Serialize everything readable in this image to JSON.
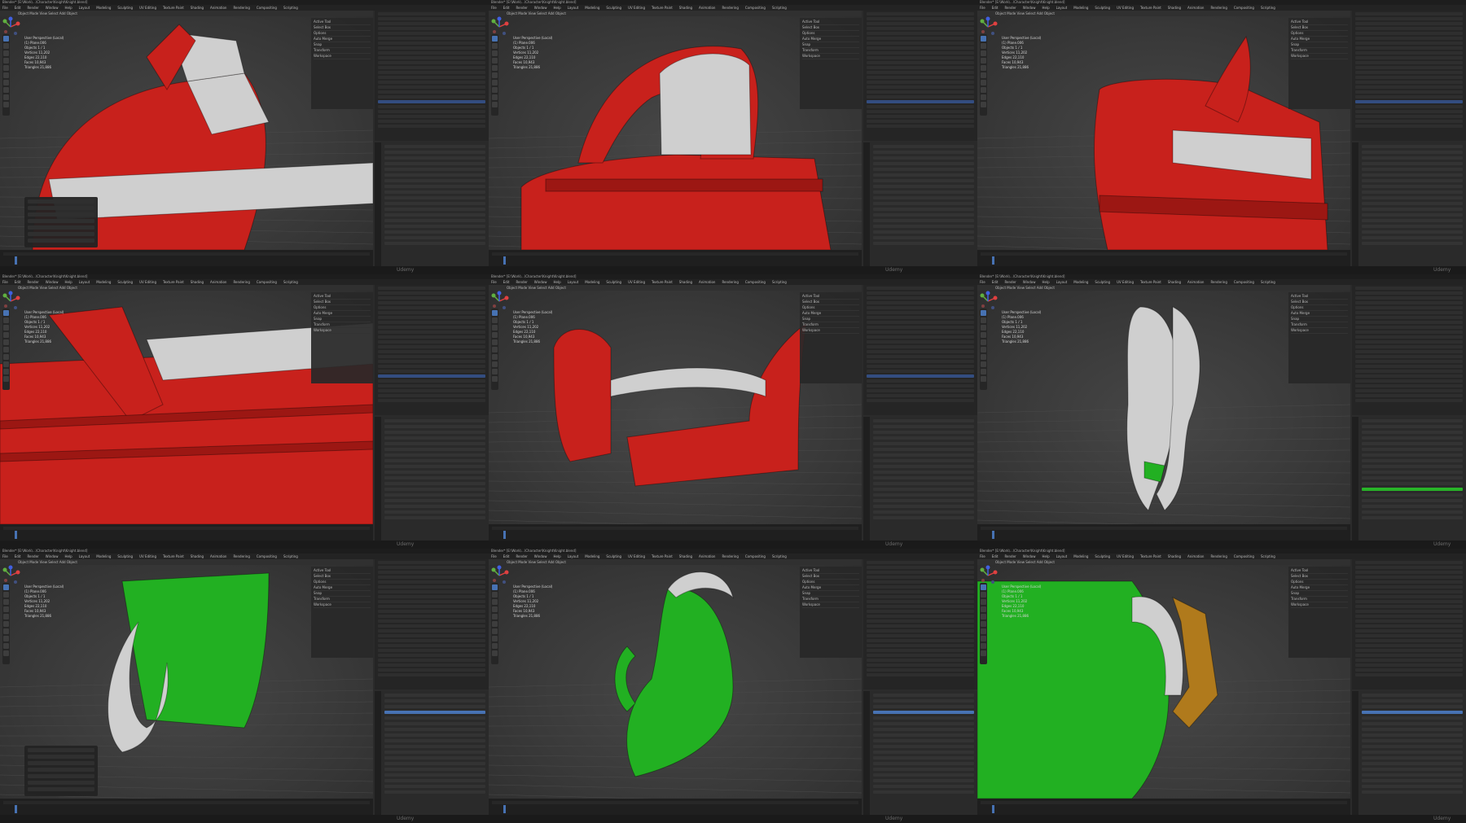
{
  "app": {
    "window_title": "Blender* [E:\\Work\\...\\Character\\Knight\\Knight.blend]",
    "menus": [
      "File",
      "Edit",
      "Render",
      "Window",
      "Help",
      "Layout",
      "Modeling",
      "Sculpting",
      "UV Editing",
      "Texture Paint",
      "Shading",
      "Animation",
      "Rendering",
      "Compositing",
      "Scripting"
    ],
    "view_header": [
      "Object Mode",
      "View",
      "Select",
      "Add",
      "Object"
    ],
    "viewport_info": [
      "User Perspective (Local)",
      "(1) Plane.006",
      "Objects 1 / 1",
      "Vertices 11,202",
      "Edges 22,110",
      "Faces 10,943",
      "Triangles 21,886"
    ],
    "npanel_title": "Active Tool",
    "npanel_rows": [
      "Select Box",
      "Options",
      "Auto Merge",
      "Snap",
      "Transform",
      "Workspace"
    ],
    "outliner_title": "Scene",
    "properties_title": "Object",
    "watermark": "Udemy"
  },
  "colors": {
    "red": "#c8211c",
    "white": "#cfcfcf",
    "green": "#22b022",
    "orange": "#b07a1c",
    "accent": "#4772b3"
  },
  "panels": [
    {
      "model": "red-helmet-rim-with-white-cloth"
    },
    {
      "model": "red-helmet-crest-with-white-interior"
    },
    {
      "model": "red-helmet-crest-side"
    },
    {
      "model": "red-rim-closeup"
    },
    {
      "model": "red-shoulder-pieces"
    },
    {
      "model": "white-sculpt-side"
    },
    {
      "model": "green-shell-with-white-strap"
    },
    {
      "model": "green-shell-wireframe"
    },
    {
      "model": "green-shell-closeup-with-orange-piece"
    }
  ]
}
